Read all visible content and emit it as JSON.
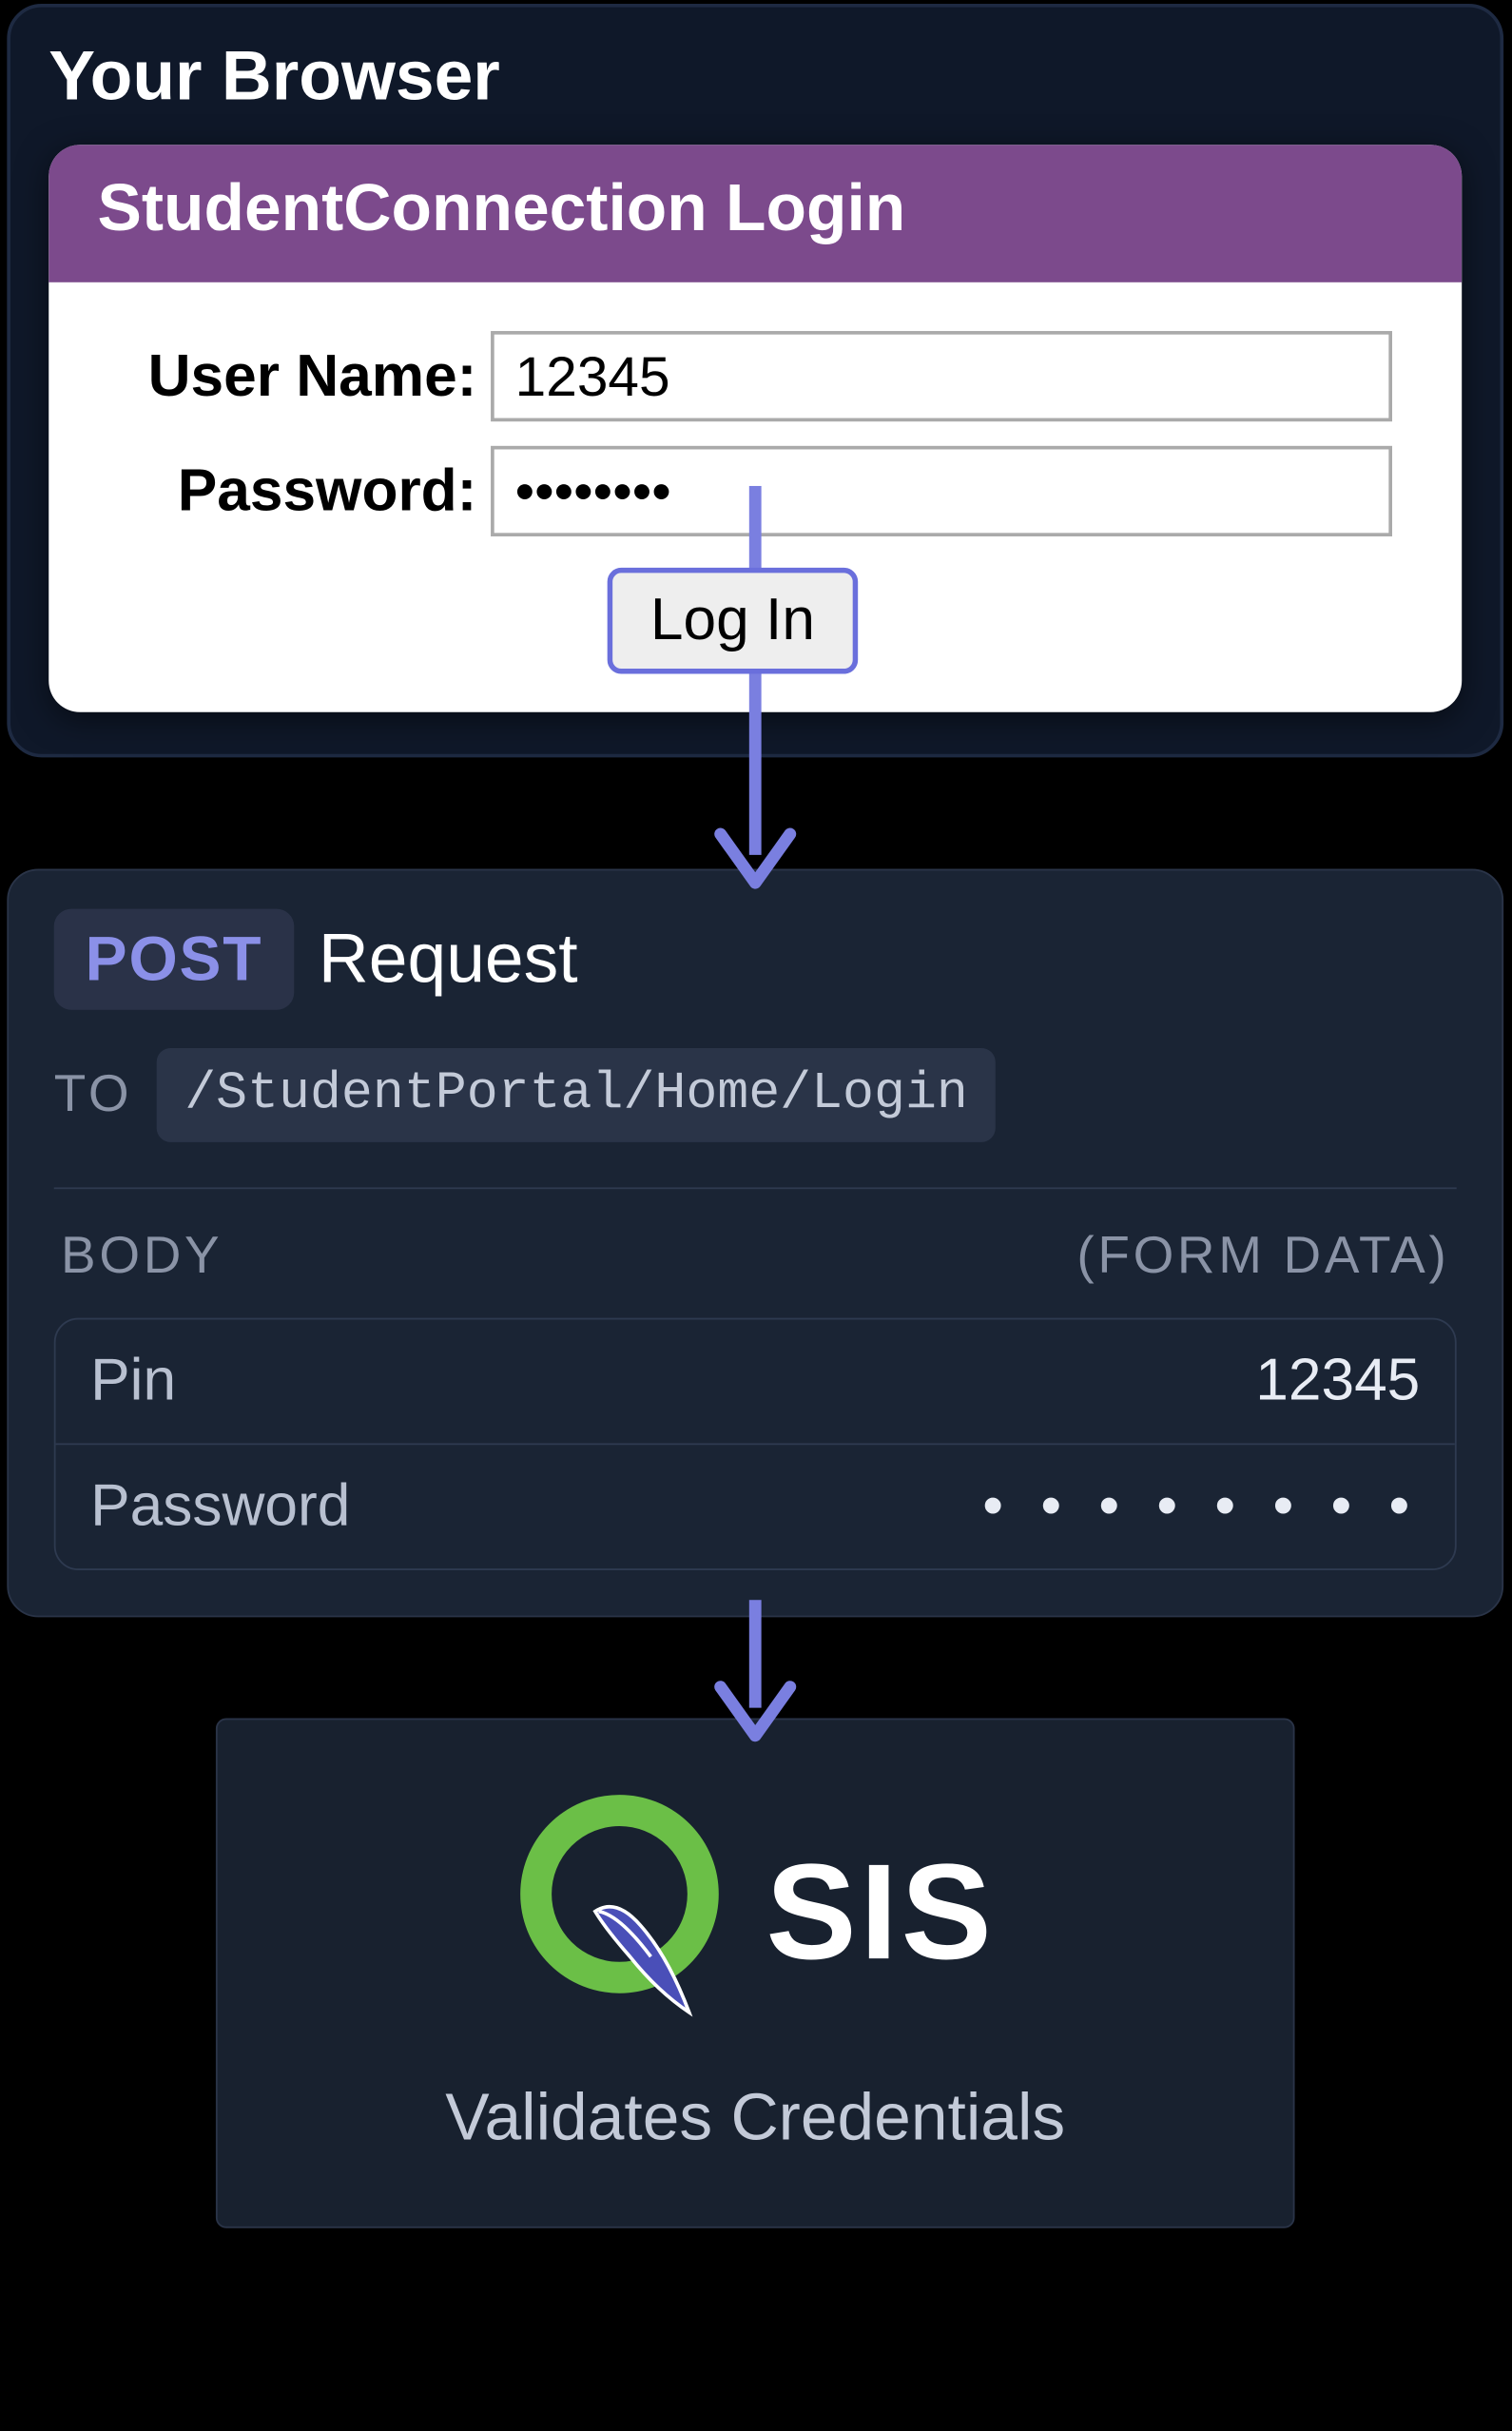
{
  "browser": {
    "title": "Your Browser",
    "login_window": {
      "header": "StudentConnection Login",
      "username_label": "User Name:",
      "username_value": "12345",
      "password_label": "Password:",
      "password_value": "••••••••",
      "button_label": "Log In"
    }
  },
  "request": {
    "method": "POST",
    "label": "Request",
    "to_label": "TO",
    "url": "/StudentPortal/Home/Login",
    "body_label": "BODY",
    "body_type": "(FORM DATA)",
    "rows": [
      {
        "key": "Pin",
        "value": "12345"
      },
      {
        "key": "Password",
        "value": "• • • • • • • •"
      }
    ]
  },
  "sis": {
    "name": "SIS",
    "caption": "Validates Credentials"
  }
}
